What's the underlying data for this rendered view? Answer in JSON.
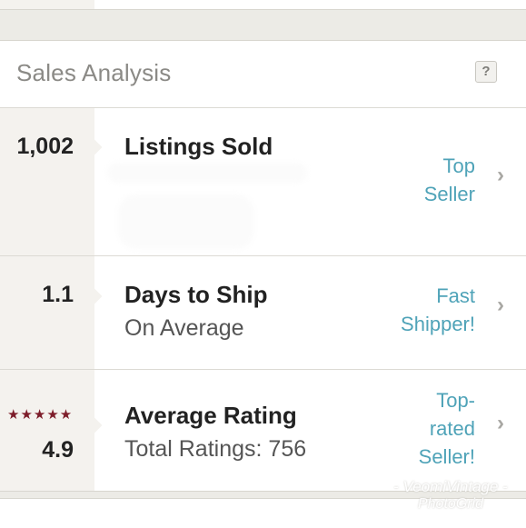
{
  "panel": {
    "title": "Sales Analysis",
    "help_icon": "?"
  },
  "rows": [
    {
      "metric": "1,002",
      "label": "Listings Sold",
      "badge_lines": [
        "Top",
        "Seller"
      ]
    },
    {
      "metric": "1.1",
      "label": "Days to Ship",
      "sublabel": "On Average",
      "badge_lines": [
        "Fast",
        "Shipper!"
      ]
    },
    {
      "stars": "★★★★★",
      "metric": "4.9",
      "label": "Average Rating",
      "sublabel": "Total Ratings: 756",
      "badge_lines": [
        "Top-",
        "rated",
        "Seller!"
      ]
    }
  ],
  "chevron": "›",
  "watermark": {
    "line1": "- VeomiVintage -",
    "line2": "PhotoGrid"
  },
  "colors": {
    "accent_link": "#4fa3b8",
    "star": "#7d1d2a"
  },
  "icons": [
    "help-icon",
    "chevron-right-icon",
    "star-icon"
  ]
}
